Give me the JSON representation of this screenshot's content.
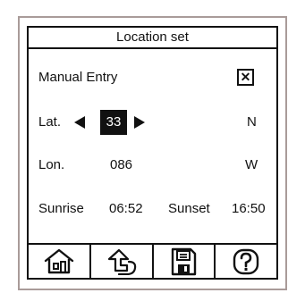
{
  "screen": {
    "title": "Location set"
  },
  "manual_entry": {
    "label": "Manual Entry",
    "checkbox_mark": "✕",
    "checked": true
  },
  "latitude": {
    "label": "Lat.",
    "value": "33",
    "hemisphere": "N"
  },
  "longitude": {
    "label": "Lon.",
    "value": "086",
    "hemisphere": "W"
  },
  "sun_times": {
    "sunrise_label": "Sunrise",
    "sunrise_time": "06:52",
    "sunset_label": "Sunset",
    "sunset_time": "16:50"
  },
  "toolbar": {
    "buttons": [
      {
        "icon": "home-icon"
      },
      {
        "icon": "back-icon"
      },
      {
        "icon": "save-icon"
      },
      {
        "icon": "help-icon"
      }
    ]
  },
  "colors": {
    "frame_border": "#a99b99",
    "ink": "#111111",
    "background": "#ffffff"
  }
}
